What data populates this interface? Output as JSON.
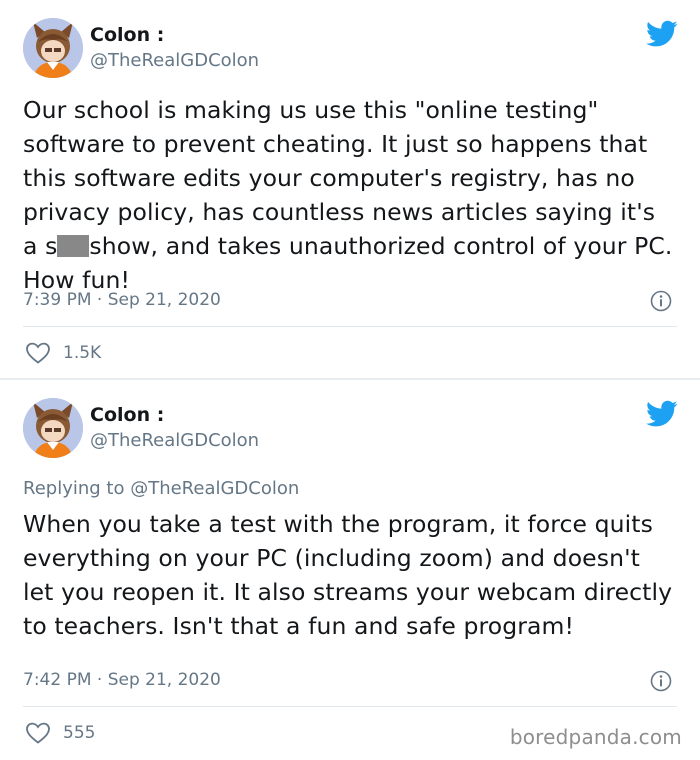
{
  "tweets": [
    {
      "author": {
        "display_name": "Colon :",
        "handle": "@TheRealGDColon"
      },
      "reply_to": "",
      "text_before_censor": "Our school is making us use this \"online testing\" software to prevent cheating. It just so happens that this software edits your computer's registry, has no privacy policy, has countless news articles saying it's a s",
      "text_after_censor": "show, and takes unauthorized control of your PC. How fun!",
      "timestamp": "7:39 PM · Sep 21, 2020",
      "likes": "1.5K",
      "icons": {
        "brand": "twitter-bird-icon",
        "info": "info-icon",
        "like": "heart-icon"
      }
    },
    {
      "author": {
        "display_name": "Colon :",
        "handle": "@TheRealGDColon"
      },
      "reply_to": "Replying to @TheRealGDColon",
      "text": "When you take a test with the program, it force quits everything on your PC (including zoom) and doesn't let you reopen it. It also streams your webcam directly to teachers. Isn't that a fun and safe program!",
      "timestamp": "7:42 PM · Sep 21, 2020",
      "likes": "555",
      "icons": {
        "brand": "twitter-bird-icon",
        "info": "info-icon",
        "like": "heart-icon"
      }
    }
  ],
  "watermark": "boredpanda.com",
  "colors": {
    "twitter_blue": "#1da1f2",
    "secondary_text": "#657786",
    "primary_text": "#14171a",
    "censor_gray": "#888888"
  }
}
